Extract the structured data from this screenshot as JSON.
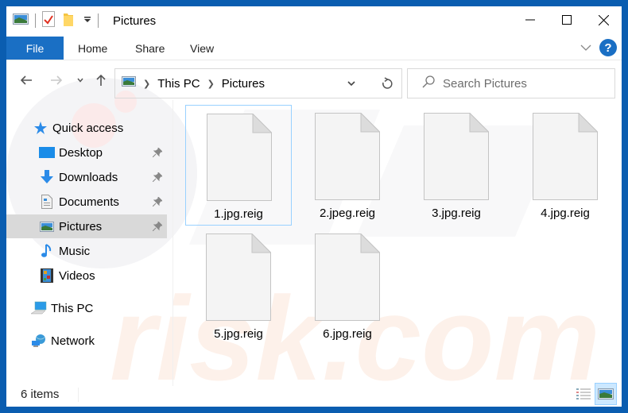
{
  "window": {
    "title": "Pictures",
    "accent": "#1a6fc4",
    "frame": "#0a5db0"
  },
  "title_controls": {
    "minimize": "minimize-icon",
    "maximize": "maximize-icon",
    "close": "close-icon"
  },
  "ribbon": {
    "tabs": [
      {
        "label": "File",
        "active": true
      },
      {
        "label": "Home"
      },
      {
        "label": "Share"
      },
      {
        "label": "View"
      }
    ],
    "help_label": "?"
  },
  "nav": {
    "breadcrumb": [
      "This PC",
      "Pictures"
    ],
    "search_placeholder": "Search Pictures"
  },
  "sidebar": {
    "items": [
      {
        "label": "Quick access",
        "icon": "star-icon"
      },
      {
        "label": "Desktop",
        "icon": "desktop-icon",
        "pinned": true
      },
      {
        "label": "Downloads",
        "icon": "download-icon",
        "pinned": true
      },
      {
        "label": "Documents",
        "icon": "documents-icon",
        "pinned": true
      },
      {
        "label": "Pictures",
        "icon": "pictures-icon",
        "pinned": true,
        "selected": true
      },
      {
        "label": "Music",
        "icon": "music-icon"
      },
      {
        "label": "Videos",
        "icon": "videos-icon"
      },
      {
        "label": "This PC",
        "icon": "computer-icon"
      },
      {
        "label": "Network",
        "icon": "network-icon"
      }
    ]
  },
  "files": [
    {
      "name": "1.jpg.reig",
      "selected": true
    },
    {
      "name": "2.jpeg.reig"
    },
    {
      "name": "3.jpg.reig"
    },
    {
      "name": "4.jpg.reig"
    },
    {
      "name": "5.jpg.reig"
    },
    {
      "name": "6.jpg.reig"
    }
  ],
  "status": {
    "item_count": "6 items",
    "view_modes": [
      "details-view",
      "large-icons-view"
    ],
    "active_view": "large-icons-view"
  }
}
